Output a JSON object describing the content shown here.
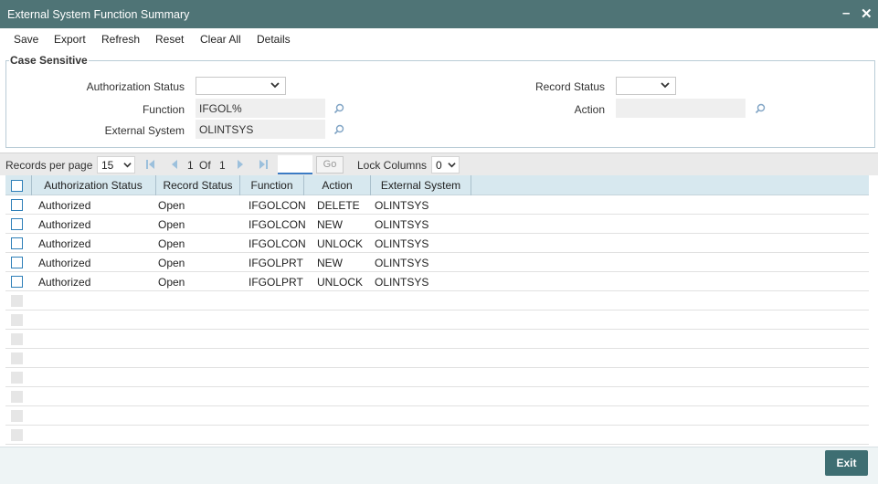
{
  "window": {
    "title": "External System Function Summary",
    "minimize_label": "–",
    "close_label": "✕"
  },
  "menu": {
    "save": "Save",
    "export": "Export",
    "refresh": "Refresh",
    "reset": "Reset",
    "clear_all": "Clear All",
    "details": "Details"
  },
  "search": {
    "legend": "Case Sensitive",
    "authorization_status_label": "Authorization Status",
    "authorization_status_value": "",
    "function_label": "Function",
    "function_value": "IFGOL%",
    "external_system_label": "External System",
    "external_system_value": "OLINTSYS",
    "record_status_label": "Record Status",
    "record_status_value": "",
    "action_label": "Action",
    "action_value": ""
  },
  "pager": {
    "records_per_page_label": "Records per page",
    "records_per_page_value": "15",
    "current_page": "1",
    "of_label": "Of",
    "total_pages": "1",
    "go_label": "Go",
    "lock_columns_label": "Lock Columns",
    "lock_columns_value": "0"
  },
  "table": {
    "headers": [
      "Authorization Status",
      "Record Status",
      "Function",
      "Action",
      "External System"
    ],
    "rows": [
      {
        "auth": "Authorized",
        "record": "Open",
        "function": "IFGOLCON",
        "action": "DELETE",
        "system": "OLINTSYS"
      },
      {
        "auth": "Authorized",
        "record": "Open",
        "function": "IFGOLCON",
        "action": "NEW",
        "system": "OLINTSYS"
      },
      {
        "auth": "Authorized",
        "record": "Open",
        "function": "IFGOLCON",
        "action": "UNLOCK",
        "system": "OLINTSYS"
      },
      {
        "auth": "Authorized",
        "record": "Open",
        "function": "IFGOLPRT",
        "action": "NEW",
        "system": "OLINTSYS"
      },
      {
        "auth": "Authorized",
        "record": "Open",
        "function": "IFGOLPRT",
        "action": "UNLOCK",
        "system": "OLINTSYS"
      }
    ]
  },
  "footer": {
    "exit_label": "Exit"
  },
  "colors": {
    "titlebar": "#4f7476",
    "header_row": "#d7e8ef",
    "checkbox": "#2e7fb8",
    "exit_button": "#3e6e72"
  },
  "icons": [
    "minimize-icon",
    "close-icon",
    "chevron-down-icon",
    "search-lens-icon",
    "first-page-icon",
    "prev-page-icon",
    "next-page-icon",
    "last-page-icon"
  ]
}
